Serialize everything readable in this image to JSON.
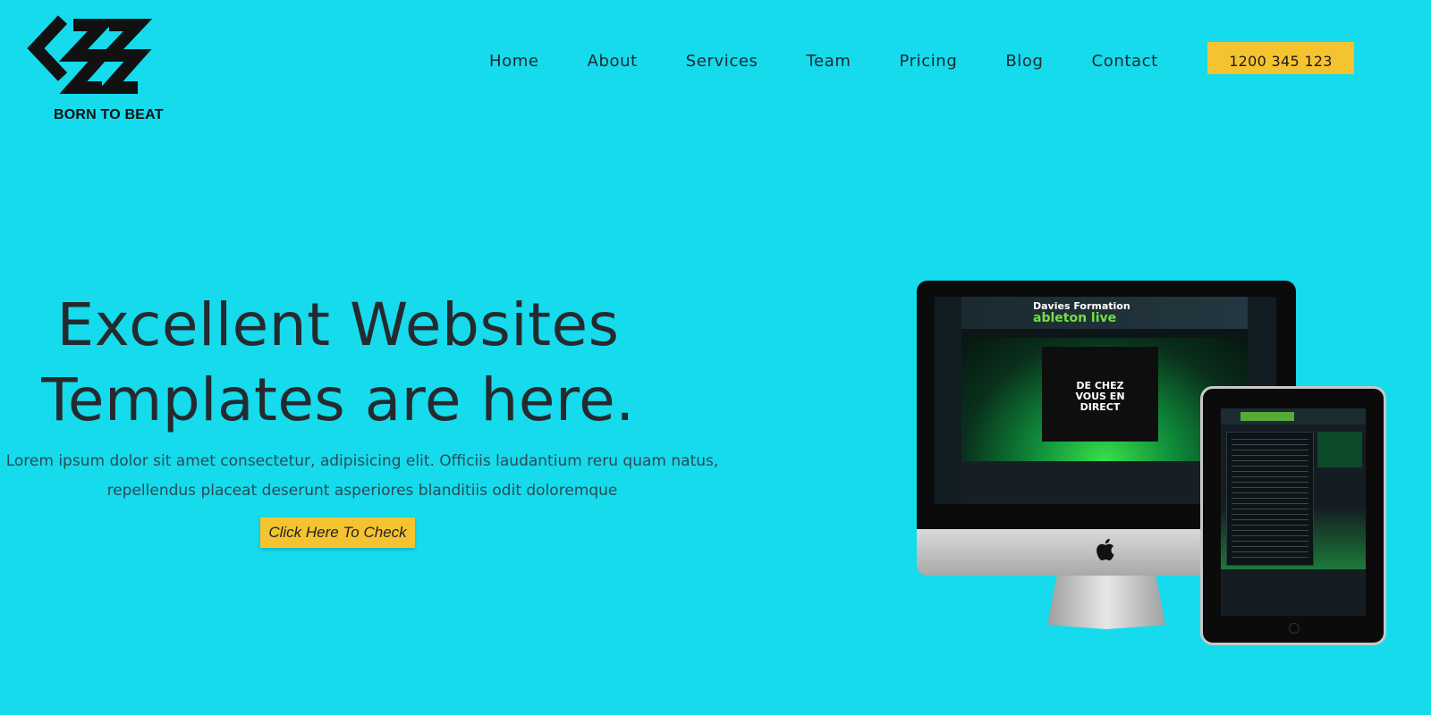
{
  "brand": {
    "logo_text": "BORN TO BEAT"
  },
  "nav": {
    "items": [
      {
        "label": "Home"
      },
      {
        "label": "About"
      },
      {
        "label": "Services"
      },
      {
        "label": "Team"
      },
      {
        "label": "Pricing"
      },
      {
        "label": "Blog"
      },
      {
        "label": "Contact"
      }
    ],
    "phone": "1200 345 123"
  },
  "hero": {
    "title_line1": "Excellent Websites",
    "title_line2": "Templates are here.",
    "subtitle_line1": "Lorem ipsum dolor sit amet consectetur, adipisicing elit. Officiis laudantium reru quam natus,",
    "subtitle_line2": "repellendus placeat deserunt asperiores blanditiis odit doloremque",
    "cta_label": "Click Here To Check"
  },
  "mockup": {
    "brand_line1": "Davies Formation",
    "brand_line2": "ableton live",
    "video_text": "DE CHEZ VOUS EN DIRECT"
  },
  "colors": {
    "background": "#15dbec",
    "accent": "#f5c330",
    "text": "#252a2f"
  }
}
